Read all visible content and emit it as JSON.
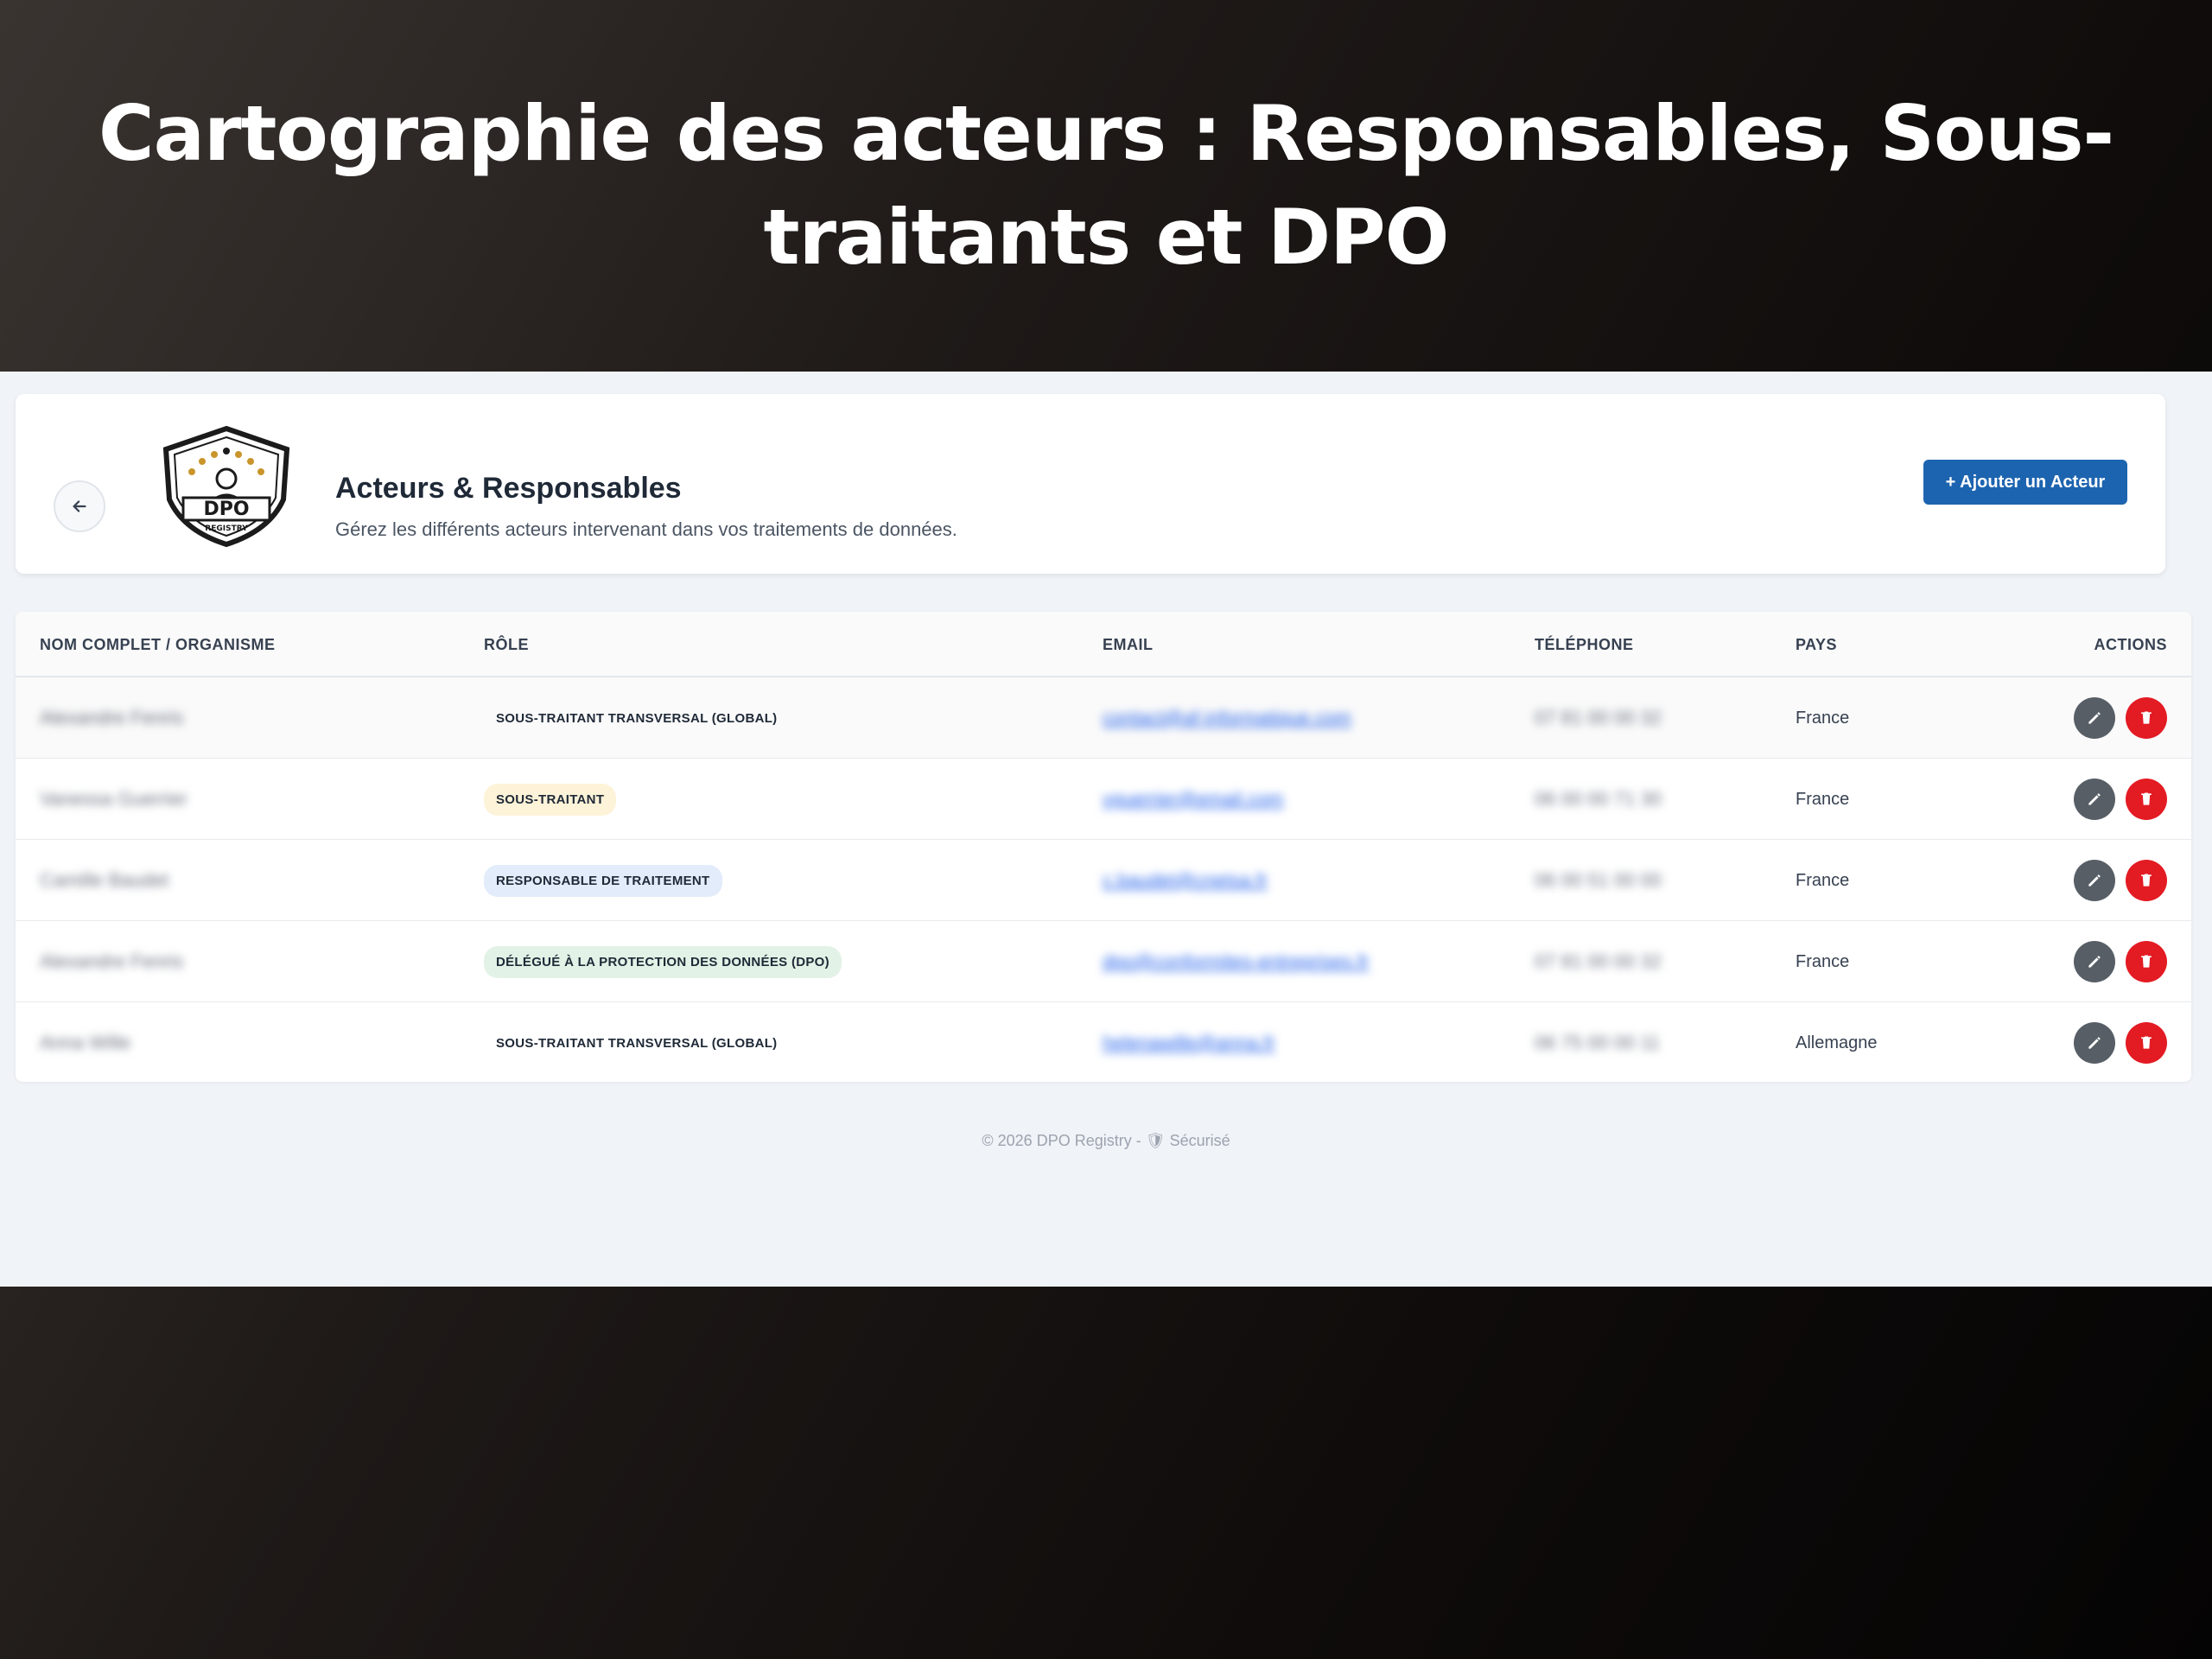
{
  "hero": {
    "title": "Cartographie des acteurs : Responsables, Sous-traitants et DPO"
  },
  "header": {
    "title": "Acteurs & Responsables",
    "subtitle": "Gérez les différents acteurs intervenant dans vos traitements de données.",
    "add_button": "+ Ajouter un Acteur",
    "logo_text": "DPO",
    "logo_subtext": "REGISTRY"
  },
  "table": {
    "columns": [
      "NOM COMPLET / ORGANISME",
      "RÔLE",
      "EMAIL",
      "TÉLÉPHONE",
      "PAYS",
      "ACTIONS"
    ],
    "rows": [
      {
        "name": "Alexandre Fenris",
        "role": "SOUS-TRAITANT TRANSVERSAL (GLOBAL)",
        "role_style": "plain",
        "email": "contact@af-informatique.com",
        "phone": "07 81 00 00 32",
        "country": "France"
      },
      {
        "name": "Vanessa Guerrier",
        "role": "SOUS-TRAITANT",
        "role_style": "yellow",
        "email": "vguerrier@email.com",
        "phone": "06 00 00 71 30",
        "country": "France"
      },
      {
        "name": "Camille Baudet",
        "role": "RESPONSABLE DE TRAITEMENT",
        "role_style": "blue",
        "email": "c.baudet@cnetsa.fr",
        "phone": "06 00 51 00 00",
        "country": "France"
      },
      {
        "name": "Alexandre Fenris",
        "role": "DÉLÉGUÉ À LA PROTECTION DES DONNÉES (DPO)",
        "role_style": "green",
        "email": "dpo@conformites-entreprises.fr",
        "phone": "07 81 00 00 32",
        "country": "France"
      },
      {
        "name": "Anna Wille",
        "role": "SOUS-TRAITANT TRANSVERSAL (GLOBAL)",
        "role_style": "plain",
        "email": "helenawille@anna.fr",
        "phone": "06 75 00 00 11",
        "country": "Allemagne"
      }
    ]
  },
  "footer": {
    "text": "© 2026 DPO Registry - 🛡 Sécurisé"
  },
  "colors": {
    "primary": "#1d64b0",
    "danger": "#e31b23",
    "edit": "#575e66"
  }
}
